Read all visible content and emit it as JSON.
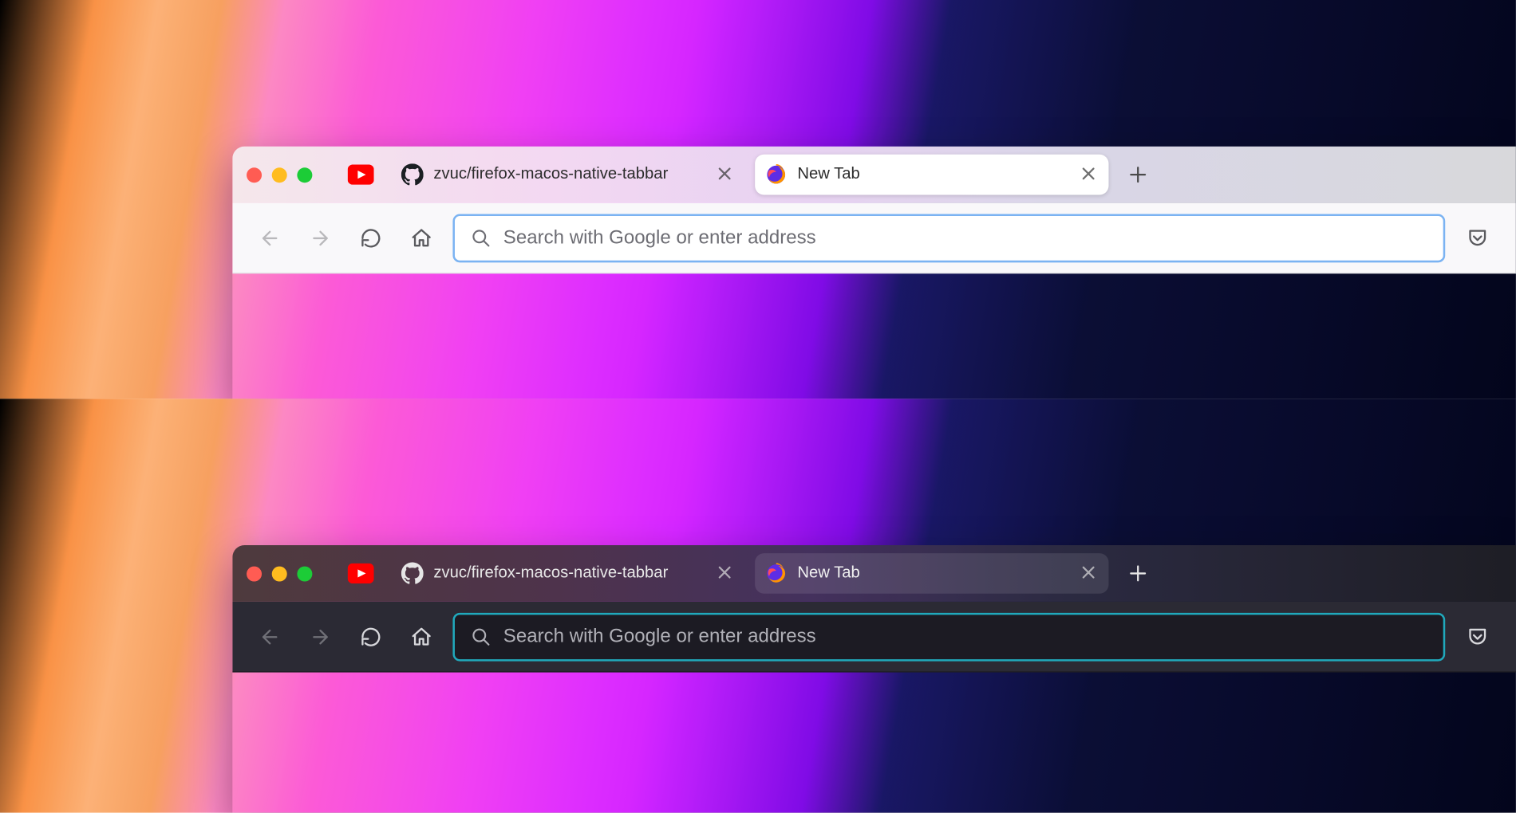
{
  "traffic": {
    "close": "close",
    "minimize": "minimize",
    "zoom": "zoom"
  },
  "tabs": {
    "pinned": {
      "icon": "youtube"
    },
    "inactive": {
      "icon": "github",
      "title": "zvuc/firefox-macos-native-tabbar"
    },
    "active": {
      "icon": "firefox",
      "title": "New Tab"
    }
  },
  "urlbar": {
    "placeholder": "Search with Google or enter address"
  },
  "colors": {
    "light_focus": "#7fb2ec",
    "dark_focus": "#2aa6b8",
    "youtube": "#ff0000",
    "traffic_red": "#ff5f57",
    "traffic_yellow": "#febc2e",
    "traffic_green": "#28c840"
  }
}
